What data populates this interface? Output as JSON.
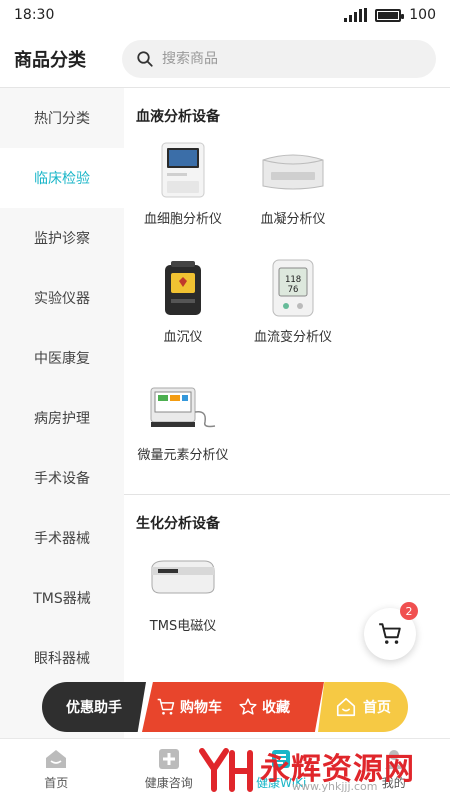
{
  "status_bar": {
    "time": "18:30",
    "battery": "100"
  },
  "header": {
    "title": "商品分类",
    "search_placeholder": "搜索商品"
  },
  "sidebar": {
    "items": [
      {
        "label": "热门分类"
      },
      {
        "label": "临床检验",
        "active": true
      },
      {
        "label": "监护诊察"
      },
      {
        "label": "实验仪器"
      },
      {
        "label": "中医康复"
      },
      {
        "label": "病房护理"
      },
      {
        "label": "手术设备"
      },
      {
        "label": "手术器械"
      },
      {
        "label": "TMS器械"
      },
      {
        "label": "眼科器械"
      }
    ]
  },
  "content": {
    "sections": [
      {
        "title": "血液分析设备",
        "items": [
          {
            "label": "血细胞分析仪"
          },
          {
            "label": "血凝分析仪"
          },
          {
            "label": "血沉仪"
          },
          {
            "label": "血流变分析仪"
          },
          {
            "label": "微量元素分析仪"
          }
        ]
      },
      {
        "title": "生化分析设备",
        "items": [
          {
            "label": "TMS电磁仪"
          }
        ]
      }
    ]
  },
  "cart": {
    "badge": "2"
  },
  "action_bar": {
    "helper": "优惠助手",
    "cart": "购物车",
    "favorite": "收藏",
    "home": "首页"
  },
  "bottom_nav": [
    {
      "label": "首页"
    },
    {
      "label": "健康咨询"
    },
    {
      "label": "健康WiKi",
      "active": true
    },
    {
      "label": "我的"
    }
  ],
  "watermark": {
    "text": "永辉资源网",
    "url": "www.yhkjjj.com"
  },
  "colors": {
    "accent": "#19b6c8",
    "red": "#e8452c",
    "yellow": "#f6c944",
    "dark": "#2f2f2f",
    "badge": "#f05050"
  }
}
